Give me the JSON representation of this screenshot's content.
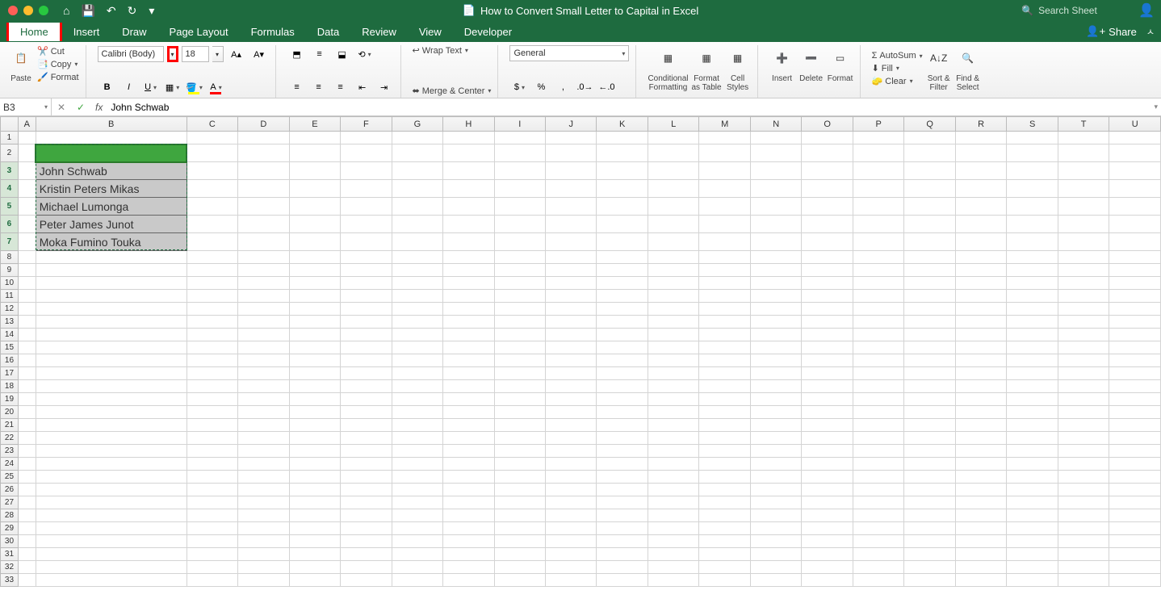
{
  "title": "How to Convert Small Letter to Capital in Excel",
  "search_placeholder": "Search Sheet",
  "share_label": "Share",
  "tabs": [
    "Home",
    "Insert",
    "Draw",
    "Page Layout",
    "Formulas",
    "Data",
    "Review",
    "View",
    "Developer"
  ],
  "active_tab": "Home",
  "clipboard": {
    "paste": "Paste",
    "cut": "Cut",
    "copy": "Copy",
    "format": "Format"
  },
  "font": {
    "name": "Calibri (Body)",
    "size": "18"
  },
  "alignment": {
    "wrap": "Wrap Text",
    "merge": "Merge & Center"
  },
  "number": {
    "format": "General"
  },
  "styles": {
    "cf": "Conditional\nFormatting",
    "fat": "Format\nas Table",
    "cs": "Cell\nStyles"
  },
  "cells": {
    "insert": "Insert",
    "delete": "Delete",
    "format": "Format"
  },
  "editing": {
    "autosum": "AutoSum",
    "fill": "Fill",
    "clear": "Clear",
    "sort": "Sort &\nFilter",
    "find": "Find &\nSelect"
  },
  "namebox": "B3",
  "formula": "John Schwab",
  "columns": [
    "A",
    "B",
    "C",
    "D",
    "E",
    "F",
    "G",
    "H",
    "I",
    "J",
    "K",
    "L",
    "M",
    "N",
    "O",
    "P",
    "Q",
    "R",
    "S",
    "T",
    "U"
  ],
  "rows": 33,
  "sheet": {
    "B3": "John Schwab",
    "B4": "Kristin Peters Mikas",
    "B5": "Michael Lumonga",
    "B6": "Peter James Junot",
    "B7": "Moka Fumino Touka"
  },
  "selection": {
    "start": "B3",
    "end": "B7"
  }
}
